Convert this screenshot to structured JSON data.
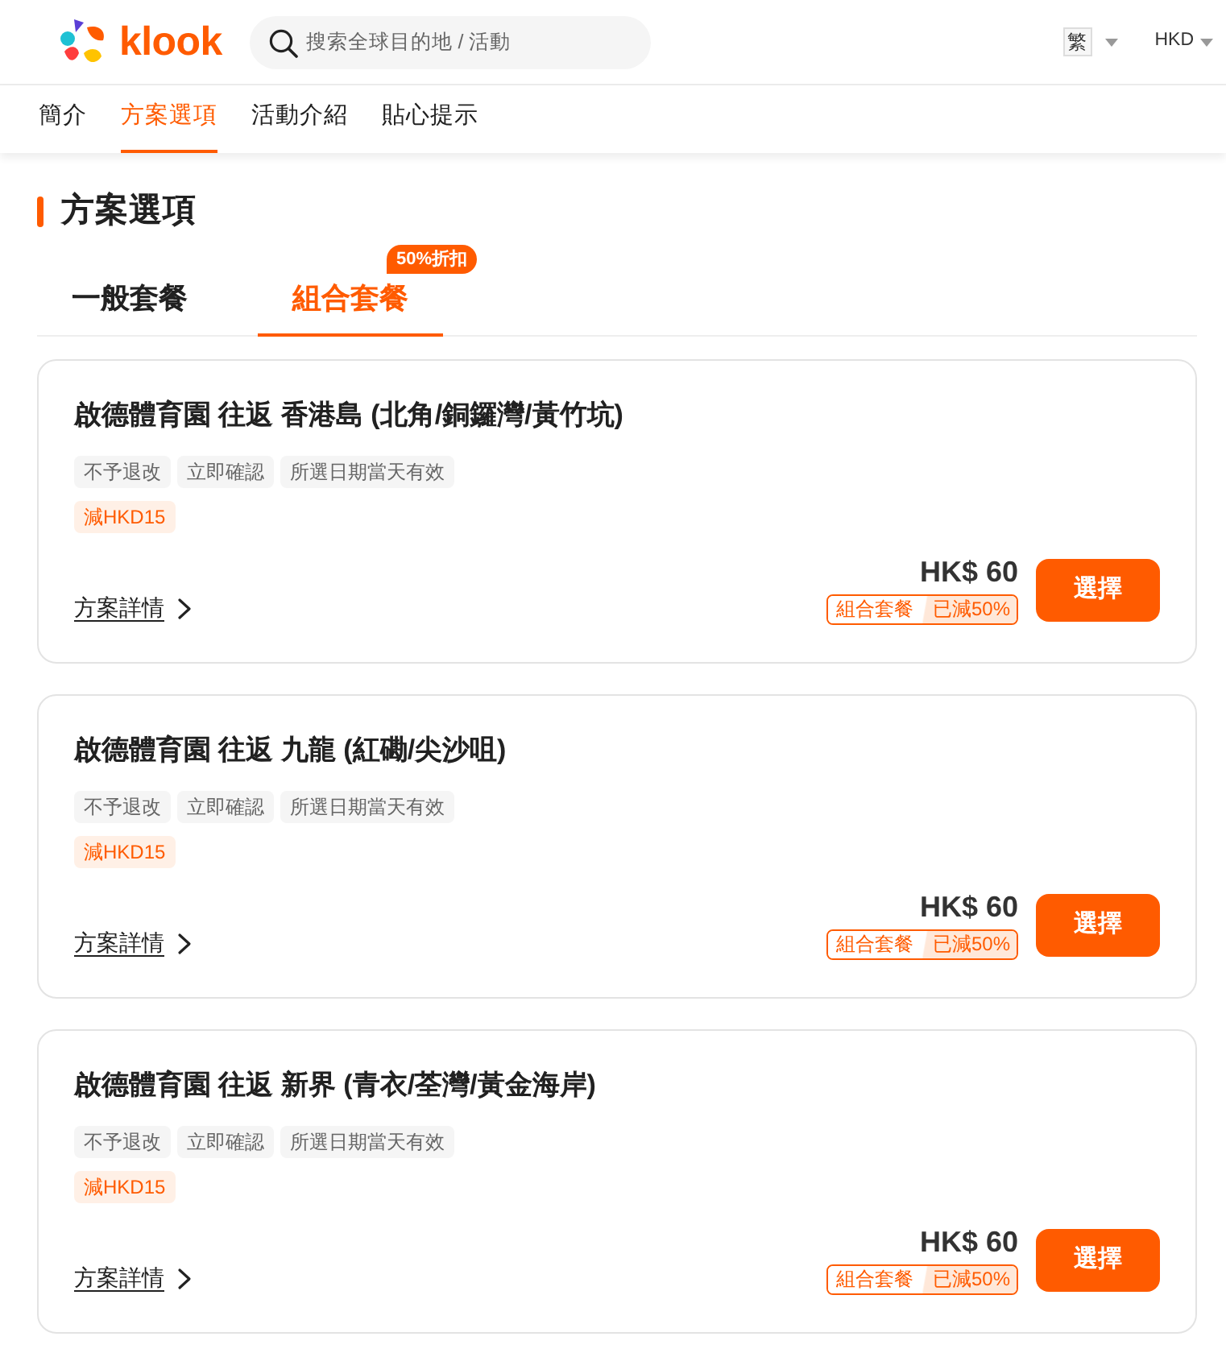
{
  "header": {
    "logo": "klook",
    "search": {
      "placeholder": "搜索全球目的地 / 活動"
    },
    "language": "繁",
    "currency": "HKD"
  },
  "nav_tabs": [
    {
      "label": "簡介",
      "selected": false
    },
    {
      "label": "方案選項",
      "selected": true
    },
    {
      "label": "活動介紹",
      "selected": false
    },
    {
      "label": "貼心提示",
      "selected": false
    }
  ],
  "section_title": "方案選項",
  "package_tabs": [
    {
      "label": "一般套餐",
      "selected": false
    },
    {
      "label": "組合套餐",
      "selected": true,
      "badge": "50%折扣"
    }
  ],
  "packages": [
    {
      "title": "啟德體育園 往返 香港島 (北角/銅鑼灣/黃竹坑)",
      "tags": [
        "不予退改",
        "立即確認",
        "所選日期當天有效"
      ],
      "promo": "減HKD15",
      "details_link": "方案詳情",
      "price": "HK$ 60",
      "combo_label": "組合套餐",
      "discount_label": "已減50%",
      "button": "選擇"
    },
    {
      "title": "啟德體育園 往返 九龍 (紅磡/尖沙咀)",
      "tags": [
        "不予退改",
        "立即確認",
        "所選日期當天有效"
      ],
      "promo": "減HKD15",
      "details_link": "方案詳情",
      "price": "HK$ 60",
      "combo_label": "組合套餐",
      "discount_label": "已減50%",
      "button": "選擇"
    },
    {
      "title": "啟德體育園 往返 新界 (青衣/荃灣/黃金海岸)",
      "tags": [
        "不予退改",
        "立即確認",
        "所選日期當天有效"
      ],
      "promo": "減HKD15",
      "details_link": "方案詳情",
      "price": "HK$ 60",
      "combo_label": "組合套餐",
      "discount_label": "已減50%",
      "button": "選擇"
    }
  ]
}
